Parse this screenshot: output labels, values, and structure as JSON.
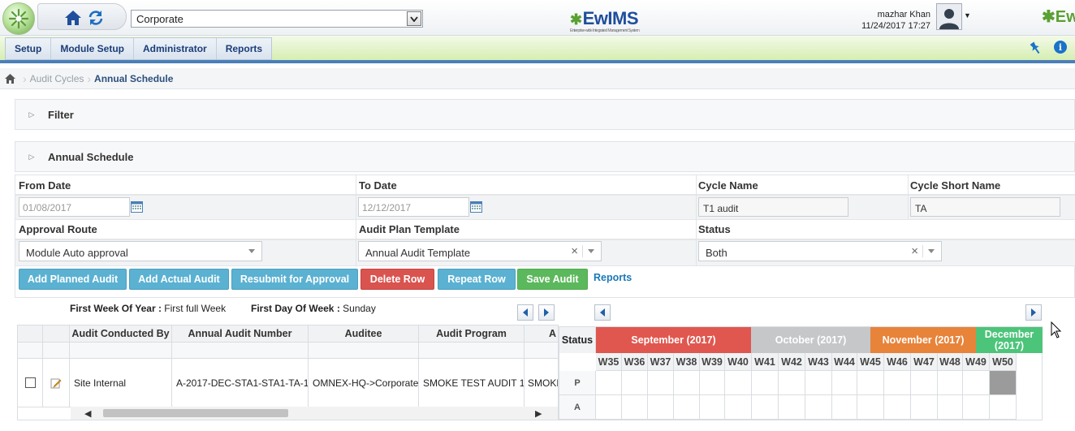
{
  "topbar": {
    "org_select_value": "Corporate",
    "brand": "EwIMS",
    "brand_tagline": "Enterprise-wide Integrated Management System",
    "user_name": "mazhar Khan",
    "user_datetime": "11/24/2017 17:27",
    "brand_right": "Ew"
  },
  "menu": {
    "items": [
      "Setup",
      "Module Setup",
      "Administrator",
      "Reports"
    ]
  },
  "breadcrumb": {
    "items": [
      "Audit Cycles",
      "Annual Schedule"
    ]
  },
  "filter_panel": {
    "title": "Filter"
  },
  "schedule_panel": {
    "title": "Annual Schedule"
  },
  "form": {
    "from_date_label": "From Date",
    "from_date_value": "01/08/2017",
    "to_date_label": "To Date",
    "to_date_value": "12/12/2017",
    "cycle_name_label": "Cycle Name",
    "cycle_name_value": "T1 audit",
    "cycle_short_label": "Cycle Short Name",
    "cycle_short_value": "TA",
    "approval_route_label": "Approval Route",
    "approval_route_value": "Module Auto approval",
    "plan_template_label": "Audit Plan Template",
    "plan_template_value": "Annual Audit Template",
    "status_label": "Status",
    "status_value": "Both"
  },
  "actions": {
    "add_planned": "Add Planned Audit",
    "add_actual": "Add Actual Audit",
    "resubmit": "Resubmit for Approval",
    "delete_row": "Delete Row",
    "repeat_row": "Repeat Row",
    "save_audit": "Save Audit",
    "reports": "Reports"
  },
  "week_info": {
    "first_week_label": "First Week Of Year :",
    "first_week_value": "First full Week",
    "first_day_label": "First Day Of Week :",
    "first_day_value": "Sunday"
  },
  "grid": {
    "columns": [
      "Audit Conducted By",
      "Annual Audit Number",
      "Auditee",
      "Audit Program",
      "A"
    ],
    "rows": [
      {
        "conducted_by": "Site Internal",
        "audit_number": "A-2017-DEC-STA1-STA1-TA-1",
        "auditee": "OMNEX-HQ->Corporate",
        "program": "SMOKE TEST AUDIT 1",
        "extra": "SMOKE"
      }
    ]
  },
  "calendar": {
    "status_label": "Status",
    "months": [
      {
        "label": "September (2017)",
        "color": "#e0574f"
      },
      {
        "label": "October (2017)",
        "color": "#c5c7c9"
      },
      {
        "label": "November (2017)",
        "color": "#e8833a"
      },
      {
        "label": "December (2017)",
        "color": "#4cc47a"
      }
    ],
    "weeks": [
      "W35",
      "W36",
      "W37",
      "W38",
      "W39",
      "W40",
      "W41",
      "W42",
      "W43",
      "W44",
      "W45",
      "W46",
      "W47",
      "W48",
      "W49",
      "W50"
    ],
    "row_labels": [
      "P",
      "A"
    ],
    "planned_filled_week": "W50"
  }
}
